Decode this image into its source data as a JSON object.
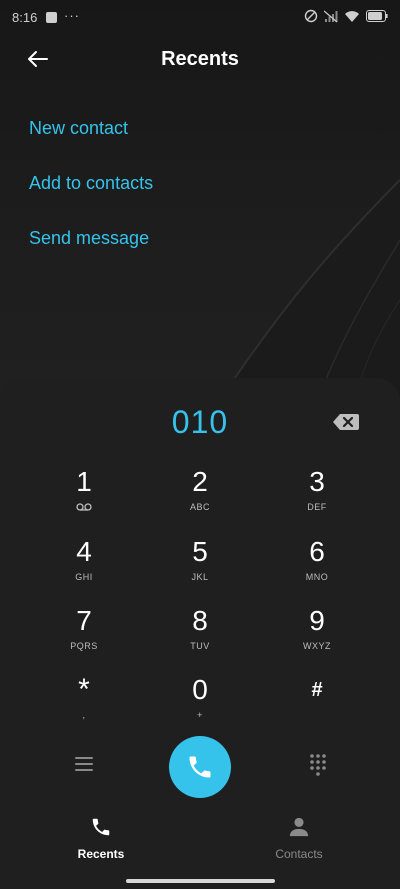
{
  "status_bar": {
    "time": "8:16",
    "more": "···",
    "icons": [
      "no-disturb-icon",
      "signal-off-icon",
      "wifi-icon",
      "battery-icon"
    ]
  },
  "header": {
    "title": "Recents",
    "back_icon": "arrow-left-icon"
  },
  "actions": {
    "new_contact": "New contact",
    "add_to_contacts": "Add to contacts",
    "send_message": "Send message"
  },
  "dialer": {
    "number": "010",
    "backspace_icon": "backspace-icon",
    "keys": [
      {
        "digit": "1",
        "letters": "",
        "icon": "voicemail-icon"
      },
      {
        "digit": "2",
        "letters": "ABC"
      },
      {
        "digit": "3",
        "letters": "DEF"
      },
      {
        "digit": "4",
        "letters": "GHI"
      },
      {
        "digit": "5",
        "letters": "JKL"
      },
      {
        "digit": "6",
        "letters": "MNO"
      },
      {
        "digit": "7",
        "letters": "PQRS"
      },
      {
        "digit": "8",
        "letters": "TUV"
      },
      {
        "digit": "9",
        "letters": "WXYZ"
      },
      {
        "digit": "*",
        "letters": ","
      },
      {
        "digit": "0",
        "letters": "+"
      },
      {
        "digit": "#",
        "letters": ""
      }
    ],
    "menu_icon": "menu-icon",
    "call_icon": "phone-icon",
    "keypad_icon": "dialpad-icon"
  },
  "nav": {
    "recents": "Recents",
    "contacts": "Contacts"
  },
  "colors": {
    "accent": "#35c3ec",
    "background": "#161616",
    "panel": "#1f1f1f"
  }
}
